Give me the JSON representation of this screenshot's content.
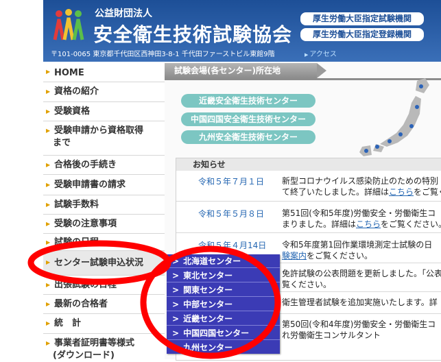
{
  "header": {
    "org_type": "公益財団法人",
    "org_name": "安全衛生技術試験協会",
    "badges": [
      "厚生労働大臣指定試験機関",
      "厚生労働大臣指定登録機関"
    ],
    "address": "〒101-0065  東京都千代田区西神田3-8-1  千代田ファーストビル東館9階",
    "access_link": "アクセス"
  },
  "sidebar": {
    "items": [
      {
        "label": "HOME"
      },
      {
        "label": "資格の紹介"
      },
      {
        "label": "受験資格"
      },
      {
        "label": "受験申請から資格取得"
      },
      {
        "label": "合格後の手続き"
      },
      {
        "label": "受験申請書の請求"
      },
      {
        "label": "試験手数料"
      },
      {
        "label": "受験の注意事項"
      },
      {
        "label": "試験の日程"
      },
      {
        "label": "センター試験申込状況"
      },
      {
        "label": "出張試験の日程"
      },
      {
        "label": "最新の合格者"
      },
      {
        "label": "統　計"
      },
      {
        "label": "事業者証明書等様式"
      }
    ],
    "item3_line2": "まで",
    "item13_line2": "(ダウンロード)"
  },
  "content": {
    "section_title": "試験会場(各センター)所在地",
    "centers": [
      "近畿安全衛生技術センター",
      "中国四国安全衛生技術センター",
      "九州安全衛生技術センター"
    ],
    "news_title": "お知らせ",
    "news": [
      {
        "date": "令和５年７月１日",
        "text1": "新型コロナウイルス感染防止のための特別",
        "text2": "て終了いたしました。詳細は",
        "link": "こちら",
        "text3": "をご覧くだ"
      },
      {
        "date": "令和５年５月８日",
        "text1": "第51回(令和5年度)労働安全・労働衛生コ",
        "text2": "まりました。詳細は",
        "link": "こちら",
        "text3": "をご覧ください。"
      },
      {
        "date": "令和５年４月14日",
        "text1": "令和5年度第1回作業環境測定士試験の日",
        "text2": "",
        "link": "験案内",
        "text3": "をご覧ください。"
      },
      {
        "date": "",
        "text1": "免許試験の公表問題を更新しました。「公表",
        "text2": "覧ください。",
        "link": "",
        "text3": ""
      },
      {
        "date": "",
        "text1": "衛生管理者試験を追加実施いたします。詳",
        "text2": "",
        "link": "",
        "text3": ""
      },
      {
        "date": "",
        "text1": "第50回(令和4年度)労働安全・労働衛生コ",
        "text2": "れ労働衛生コンサルタント",
        "link": "",
        "text3": ""
      }
    ]
  },
  "dropdown": {
    "items": [
      "北海道センター",
      "東北センター",
      "関東センター",
      "中部センター",
      "近畿センター",
      "中国四国センター",
      "九州センター"
    ]
  },
  "colors": {
    "header_blue": "#1d4f97",
    "dropdown_blue": "#3b3bb5",
    "center_teal": "#7cc6c2",
    "highlight_red": "#ff0000",
    "link_blue": "#2466b2"
  }
}
